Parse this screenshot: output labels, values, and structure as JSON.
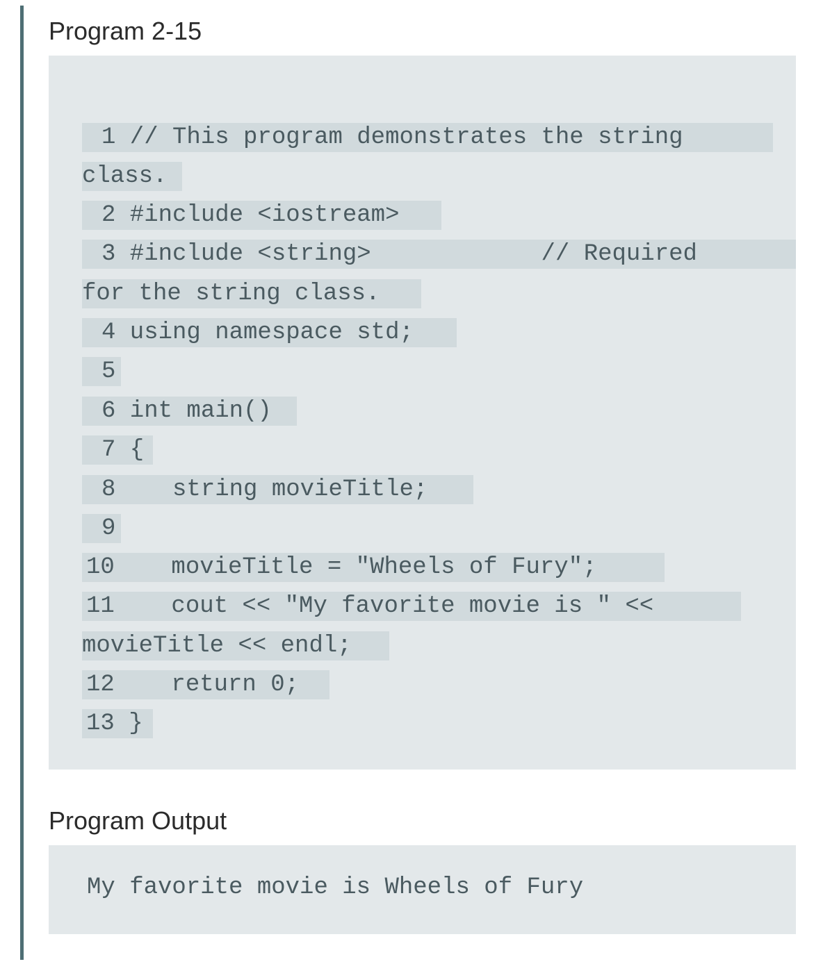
{
  "program": {
    "title": "Program 2-15",
    "code_lines": [
      "1 // This program demonstrates the string",
      "class.",
      "2 #include <iostream>",
      "3 #include <string>            // Required",
      "for the string class.",
      "4 using namespace std;",
      "5",
      "6 int main()",
      "7 {",
      "8    string movieTitle;",
      "9",
      "10    movieTitle = \"Wheels of Fury\";",
      "11    cout << \"My favorite movie is \" <<",
      "movieTitle << endl;",
      "12    return 0;",
      "13 }"
    ]
  },
  "output": {
    "title": "Program Output",
    "text": "My favorite movie is Wheels of Fury"
  }
}
